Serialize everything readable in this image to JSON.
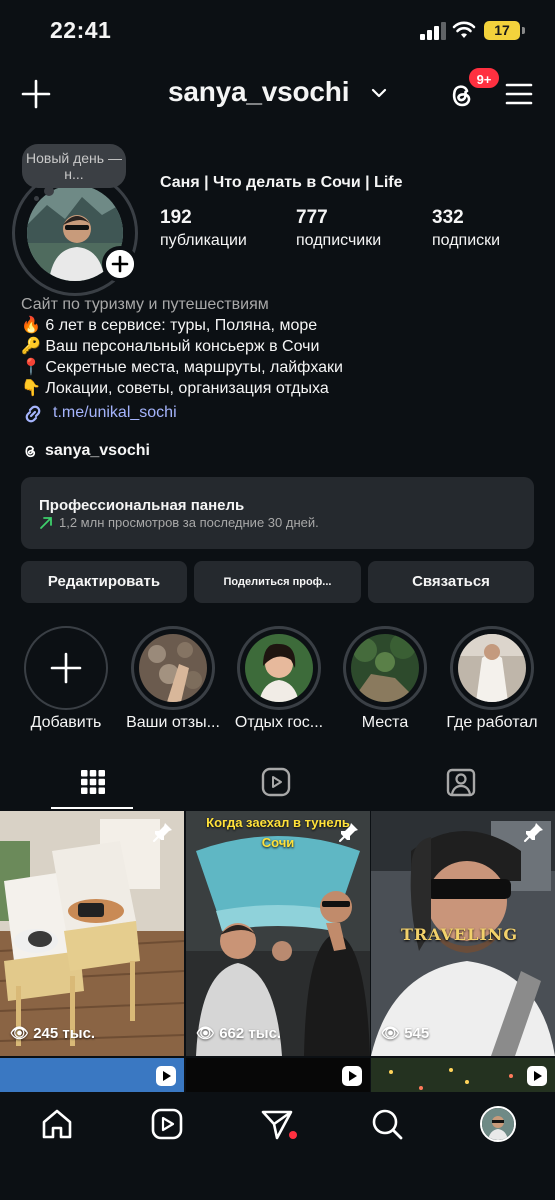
{
  "status_bar": {
    "time": "22:41",
    "battery": "17"
  },
  "header": {
    "username": "sanya_vsochi",
    "notification_badge": "9+"
  },
  "profile": {
    "note": "Новый день — н...",
    "display_name": "Саня | Что делать в Сочи | Life",
    "stats": [
      {
        "value": "192",
        "label": "публикации"
      },
      {
        "value": "777",
        "label": "подписчики"
      },
      {
        "value": "332",
        "label": "подписки"
      }
    ],
    "bio": {
      "category": "Сайт по туризму и путешествиям",
      "lines": [
        "🔥 6 лет в сервисе: туры, Поляна, море",
        "🔑 Ваш персональный консьерж в Сочи",
        "📍 Секретные места, маршруты, лайфхаки",
        "👇 Локации, советы, организация отдыха"
      ],
      "link": "t.me/unikal_sochi",
      "threads_handle": "sanya_vsochi"
    }
  },
  "pro_panel": {
    "title": "Профессиональная панель",
    "subtitle": "1,2 млн просмотров за последние 30 дней."
  },
  "actions": {
    "edit": "Редактировать",
    "share": "Поделиться проф...",
    "contact": "Связаться"
  },
  "highlights": [
    {
      "label": "Добавить"
    },
    {
      "label": "Ваши отзы..."
    },
    {
      "label": "Отдых гос..."
    },
    {
      "label": "Места"
    },
    {
      "label": "Где работал"
    }
  ],
  "posts": [
    {
      "views": "245 тыс.",
      "caption": ""
    },
    {
      "views": "662 тыс.",
      "caption": "Когда заехал в тунель",
      "caption2": "Сочи"
    },
    {
      "views": "545",
      "caption": "TRAVELING"
    }
  ],
  "colors": {
    "background": "#0c1014",
    "panel": "#25292e",
    "link": "#a5b4fc",
    "badge": "#ff3040",
    "growth": "#3ecf6b"
  }
}
